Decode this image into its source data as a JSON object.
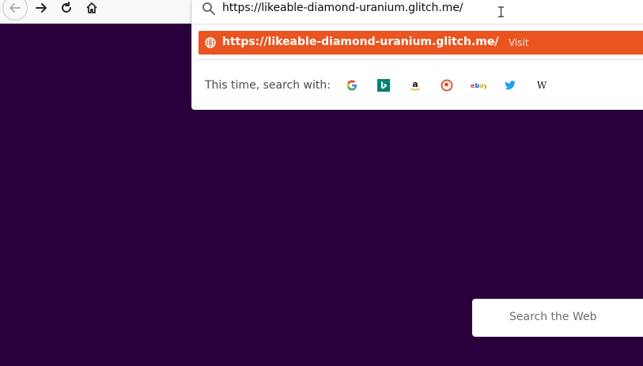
{
  "toolbar": {
    "back_icon": "arrow-left-icon",
    "forward_icon": "arrow-right-icon",
    "reload_icon": "reload-icon",
    "home_icon": "home-icon"
  },
  "urlbar": {
    "value": "https://likeable-diamond-uranium.glitch.me/",
    "search_icon": "search-icon"
  },
  "dropdown": {
    "result": {
      "url": "https://likeable-diamond-uranium.glitch.me/",
      "separator": "—",
      "action": "Visit",
      "icon": "globe-icon",
      "highlight_color": "#e95420"
    },
    "oneoff_label": "This time, search with:",
    "engines": [
      {
        "name": "google",
        "glyph": "G"
      },
      {
        "name": "bing",
        "glyph": "b"
      },
      {
        "name": "amazon",
        "glyph": "a"
      },
      {
        "name": "duckduckgo",
        "glyph": "D"
      },
      {
        "name": "ebay",
        "glyph": "ebay"
      },
      {
        "name": "twitter",
        "glyph": "bird"
      },
      {
        "name": "wikipedia",
        "glyph": "W"
      }
    ]
  },
  "page": {
    "background_color": "#2a003c",
    "search_placeholder": "Search the Web"
  }
}
